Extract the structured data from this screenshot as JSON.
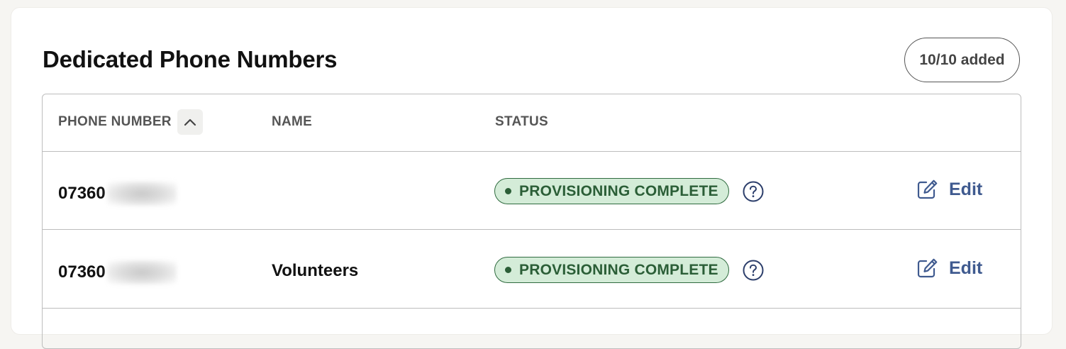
{
  "card": {
    "title": "Dedicated Phone Numbers",
    "count_label": "10/10 added"
  },
  "table": {
    "columns": {
      "phone": "PHONE NUMBER",
      "name": "NAME",
      "status": "STATUS"
    },
    "sort": {
      "column": "phone",
      "direction": "ascending",
      "icon": "chevron-up-icon"
    },
    "rows": [
      {
        "phone_prefix": "07360",
        "phone_redacted": true,
        "name": "",
        "status": "PROVISIONING COMPLETE",
        "edit_label": "Edit"
      },
      {
        "phone_prefix": "07360",
        "phone_redacted": true,
        "name": "Volunteers",
        "status": "PROVISIONING COMPLETE",
        "edit_label": "Edit"
      }
    ]
  },
  "icons": {
    "help": "question-circle-icon",
    "edit": "pencil-square-icon"
  },
  "colors": {
    "status_bg": "#d4ecd8",
    "status_text": "#2b5e37",
    "link": "#3f5a8f",
    "background": "#f6f5f2"
  }
}
